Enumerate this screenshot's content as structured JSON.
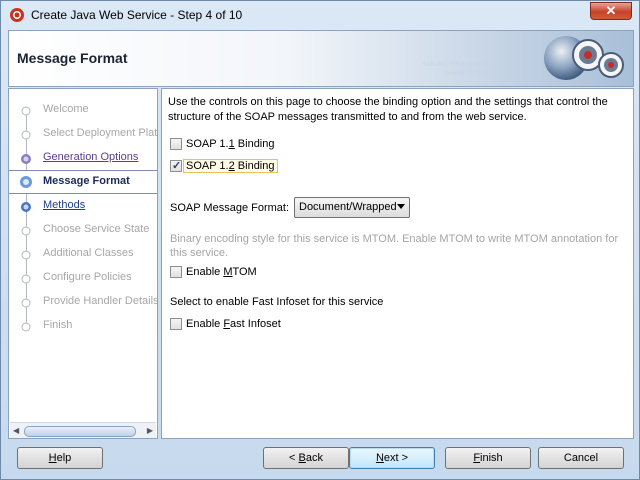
{
  "window": {
    "title": "Create Java Web Service - Step 4 of 10",
    "close_glyph": "✕"
  },
  "banner": {
    "title": "Message Format"
  },
  "nav": {
    "items": [
      {
        "label": "Welcome",
        "state": "disabled"
      },
      {
        "label": "Select Deployment Platf",
        "state": "disabled"
      },
      {
        "label": "Generation Options",
        "state": "visited"
      },
      {
        "label": "Message Format",
        "state": "current"
      },
      {
        "label": "Methods",
        "state": "link"
      },
      {
        "label": "Choose Service State",
        "state": "disabled"
      },
      {
        "label": "Additional Classes",
        "state": "disabled"
      },
      {
        "label": "Configure Policies",
        "state": "disabled"
      },
      {
        "label": "Provide Handler Details",
        "state": "disabled"
      },
      {
        "label": "Finish",
        "state": "disabled"
      }
    ]
  },
  "main": {
    "intro": "Use the controls on this page to choose the binding option and the settings that control the structure of the SOAP messages transmitted to and from the web service.",
    "soap11": {
      "pre": "SOAP 1.",
      "mnemonic": "1",
      "post": " Binding",
      "checked": false
    },
    "soap12": {
      "pre": "SOAP 1.",
      "mnemonic": "2",
      "post": " Binding",
      "checked": true
    },
    "message_format_label": "SOAP Message Format:",
    "message_format_value": "Document/Wrapped",
    "mtom_hint": "Binary encoding style for this service is MTOM. Enable MTOM to write MTOM annotation for this service.",
    "mtom": {
      "pre": "Enable ",
      "mnemonic": "M",
      "post": "TOM",
      "checked": false
    },
    "fast_infoset_label": "Select to enable Fast Infoset for this service",
    "fast_infoset": {
      "pre": "Enable ",
      "mnemonic": "F",
      "post": "ast Infoset",
      "checked": false
    }
  },
  "buttons": {
    "help": {
      "mnemonic": "H",
      "post": "elp"
    },
    "back": {
      "pre": "< ",
      "mnemonic": "B",
      "post": "ack"
    },
    "next": {
      "mnemonic": "N",
      "post": "ext >"
    },
    "finish": {
      "mnemonic": "F",
      "post": "inish"
    },
    "cancel": "Cancel"
  },
  "colors": {
    "accent": "#3c7fb1",
    "current_nav": "#1b2a5a",
    "visited_nav": "#5b3b8a"
  }
}
